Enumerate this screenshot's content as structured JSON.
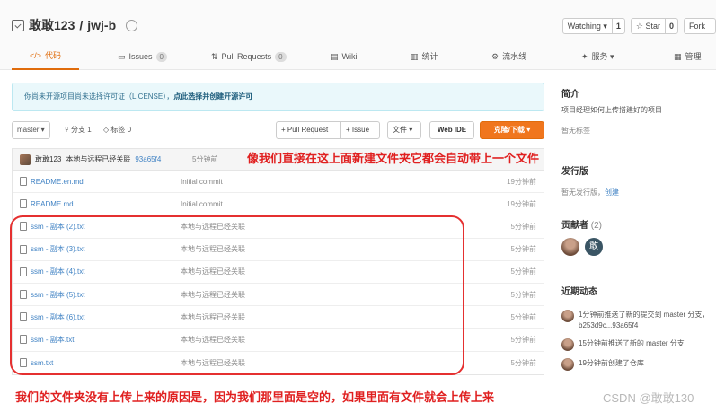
{
  "repo": {
    "owner": "敢敢123",
    "sep": "/",
    "name": "jwj-b",
    "watch_label": "Watching ▾",
    "watch_count": "1",
    "star_label": "☆ Star",
    "star_count": "0",
    "fork_label": "Fork"
  },
  "tabs": [
    {
      "label": "代码",
      "icon": "</>"
    },
    {
      "label": "Issues",
      "count": "0"
    },
    {
      "label": "Pull Requests",
      "count": "0"
    },
    {
      "label": "Wiki"
    },
    {
      "label": "统计"
    },
    {
      "label": "流水线"
    },
    {
      "label": "服务 ▾"
    },
    {
      "label": "管理"
    }
  ],
  "license": {
    "text": "你尚未开源项目尚未选择许可证（LICENSE），",
    "link": "点此选择并创建开源许可"
  },
  "toolbar": {
    "branch": "master ▾",
    "branches": "分支 1",
    "tags": "标签 0",
    "pull_request": "+ Pull Request",
    "issue": "+ Issue",
    "file": "文件 ▾",
    "web_ide": "Web IDE",
    "clone": "克隆/下载 ▾"
  },
  "commit": {
    "author": "敢敢123",
    "message": "本地与远程已经关联",
    "hash": "93a65f4",
    "time": "5分钟前"
  },
  "files": [
    {
      "name": "README.en.md",
      "message": "Initial commit",
      "time": "19分钟前"
    },
    {
      "name": "README.md",
      "message": "Initial commit",
      "time": "19分钟前"
    },
    {
      "name": "ssm - 副本 (2).txt",
      "message": "本地与远程已经关联",
      "time": "5分钟前"
    },
    {
      "name": "ssm - 副本 (3).txt",
      "message": "本地与远程已经关联",
      "time": "5分钟前"
    },
    {
      "name": "ssm - 副本 (4).txt",
      "message": "本地与远程已经关联",
      "time": "5分钟前"
    },
    {
      "name": "ssm - 副本 (5).txt",
      "message": "本地与远程已经关联",
      "time": "5分钟前"
    },
    {
      "name": "ssm - 副本 (6).txt",
      "message": "本地与远程已经关联",
      "time": "5分钟前"
    },
    {
      "name": "ssm - 副本.txt",
      "message": "本地与远程已经关联",
      "time": "5分钟前"
    },
    {
      "name": "ssm.txt",
      "message": "本地与远程已经关联",
      "time": "5分钟前"
    }
  ],
  "sidebar": {
    "intro_title": "简介",
    "intro_text": "项目经理如何上传搭建好的项目",
    "no_tags": "暂无标签",
    "release_title": "发行版",
    "no_release": "暂无发行版，",
    "create": "创建",
    "contrib_title": "贡献者",
    "contrib_count": "(2)",
    "contrib_initial": "敢",
    "activity_title": "近期动态",
    "activities": [
      "1分钟前推送了新的提交到 master 分支，b253d9c...93a65f4",
      "15分钟前推送了新的 master 分支",
      "19分钟前创建了仓库"
    ]
  },
  "annotations": {
    "top": "像我们直接在这上面新建文件夹它都会自动带上一个文件",
    "bottom": "我们的文件夹没有上传上来的原因是，因为我们那里面是空的，如果里面有文件就会上传上来"
  },
  "watermark": "CSDN @敢敢130",
  "colors": {
    "accent": "#e06c0c",
    "link": "#4183c4",
    "annotation": "#e02020"
  }
}
